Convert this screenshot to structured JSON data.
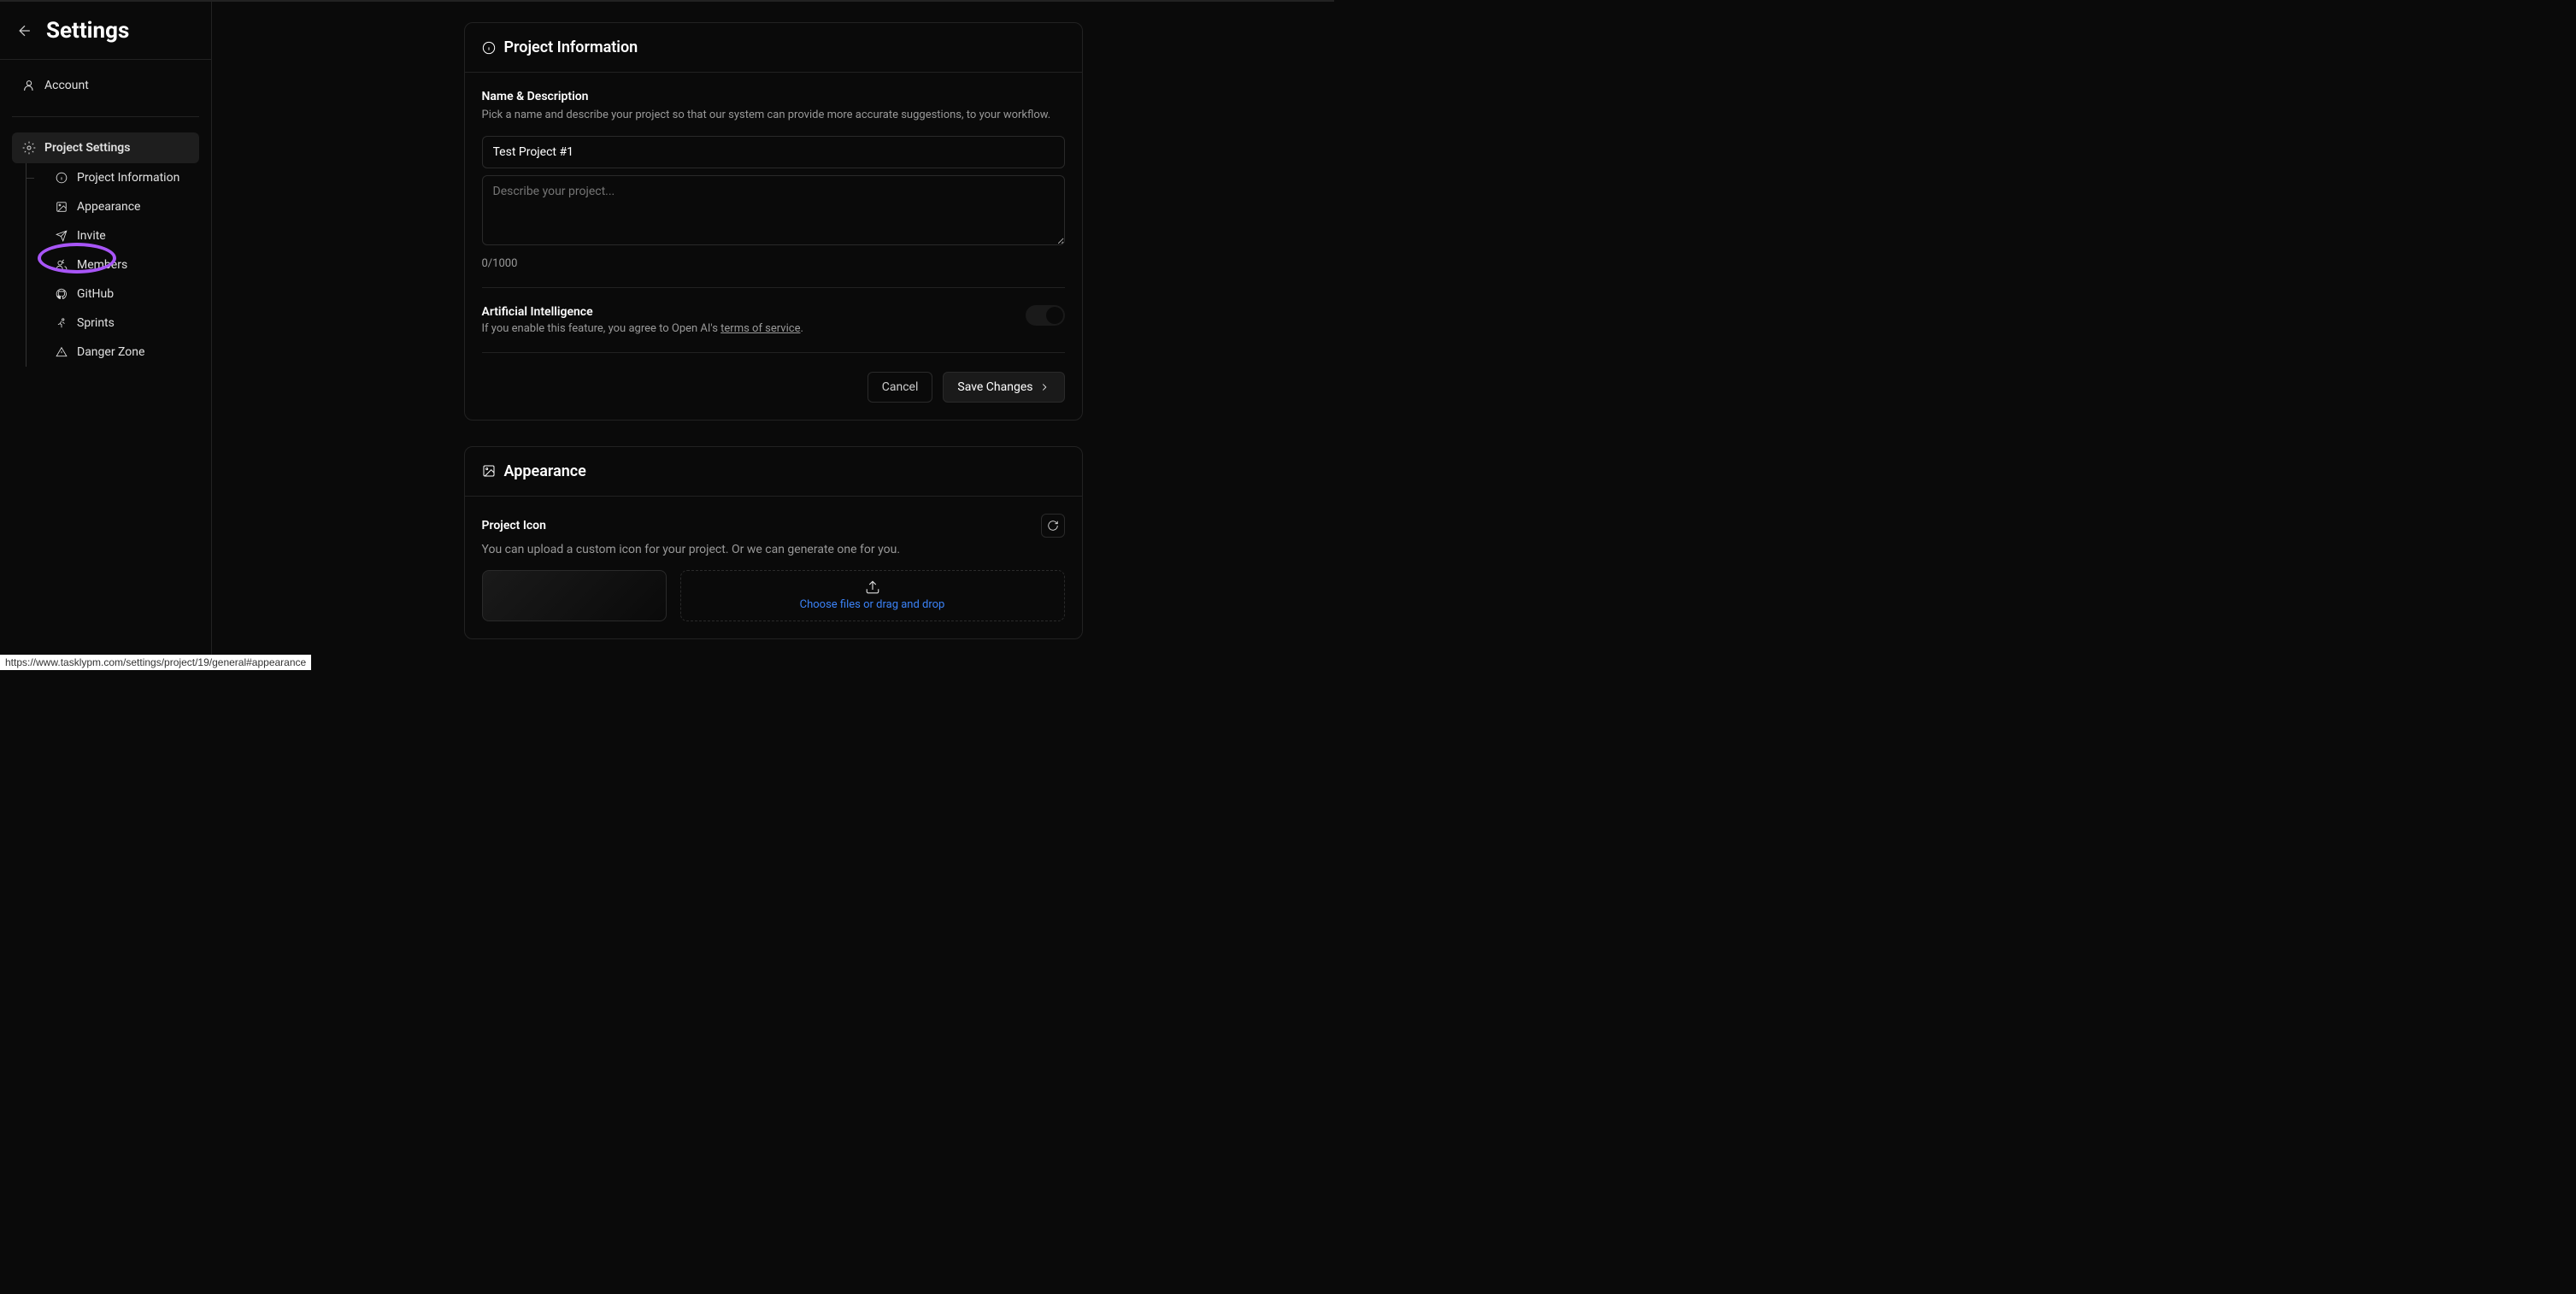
{
  "header": {
    "title": "Settings"
  },
  "sidebar": {
    "account": "Account",
    "project_settings": "Project Settings",
    "subs": {
      "project_information": "Project Information",
      "appearance": "Appearance",
      "invite": "Invite",
      "members": "Members",
      "github": "GitHub",
      "sprints": "Sprints",
      "danger_zone": "Danger Zone"
    }
  },
  "project_info": {
    "panel_title": "Project Information",
    "name_desc_label": "Name & Description",
    "name_desc_help": "Pick a name and describe your project so that our system can provide more accurate suggestions, to your workflow.",
    "name_value": "Test Project #1",
    "desc_placeholder": "Describe your project...",
    "char_count": "0/1000",
    "ai_label": "Artificial Intelligence",
    "ai_help_prefix": "If you enable this feature, you agree to Open AI's ",
    "ai_help_link": "terms of service",
    "ai_help_suffix": ".",
    "cancel": "Cancel",
    "save": "Save Changes"
  },
  "appearance": {
    "panel_title": "Appearance",
    "icon_label": "Project Icon",
    "icon_help": "You can upload a custom icon for your project. Or we can generate one for you.",
    "upload_text": "Choose files or drag and drop"
  },
  "status_url": "https://www.tasklypm.com/settings/project/19/general#appearance"
}
